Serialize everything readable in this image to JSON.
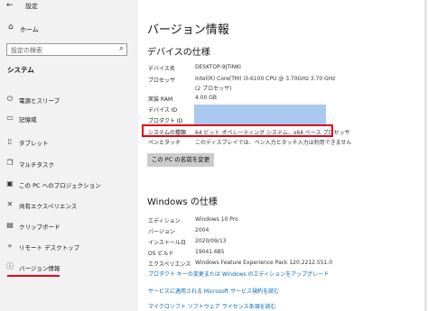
{
  "window": {
    "title": "設定",
    "back_icon": "back-arrow-icon"
  },
  "sidebar": {
    "home_label": "ホーム",
    "search_placeholder": "設定の検索",
    "section_title": "システム",
    "items": [
      {
        "label": "電源とスリープ",
        "icon": "power-icon",
        "glyph": "⏻"
      },
      {
        "label": "記憶域",
        "icon": "storage-icon",
        "glyph": "▭"
      },
      {
        "label": "タブレット",
        "icon": "tablet-icon",
        "glyph": "▯"
      },
      {
        "label": "マルチタスク",
        "icon": "multitask-icon",
        "glyph": "❐"
      },
      {
        "label": "この PC へのプロジェクション",
        "icon": "projection-icon",
        "glyph": "▣"
      },
      {
        "label": "共有エクスペリエンス",
        "icon": "shared-experience-icon",
        "glyph": "✕"
      },
      {
        "label": "クリップボード",
        "icon": "clipboard-icon",
        "glyph": "▤"
      },
      {
        "label": "リモート デスクトップ",
        "icon": "remote-desktop-icon",
        "glyph": "»"
      },
      {
        "label": "バージョン情報",
        "icon": "info-icon",
        "glyph": "ⓘ",
        "selected": true
      }
    ]
  },
  "main": {
    "title": "バージョン情報",
    "device_spec_heading": "デバイスの仕様",
    "device_specs": [
      {
        "key": "デバイス名",
        "value": "DESKTOP-9JTINKI"
      },
      {
        "key": "プロセッサ",
        "value": "Intel(R) Core(TM) i3-6100 CPU @ 3.70GHz   3.70 GHz"
      },
      {
        "key": "",
        "value": "(2 プロセッサ)"
      },
      {
        "key": "実装 RAM",
        "value": "4.00 GB"
      },
      {
        "key": "デバイス ID",
        "value": ""
      },
      {
        "key": "プロダクト ID",
        "value": ""
      },
      {
        "key": "システムの種類",
        "value": "64 ビット オペレーティング システム、x64 ベース プロセッサ"
      },
      {
        "key": "ペンとタッチ",
        "value": "このディスプレイでは、ペン入力とタッチ入力は利用できません"
      }
    ],
    "rename_button": "この PC の名前を変更",
    "windows_spec_heading": "Windows の仕様",
    "windows_specs": [
      {
        "key": "エディション",
        "value": "Windows 10 Pro"
      },
      {
        "key": "バージョン",
        "value": "2004"
      },
      {
        "key": "インストール日",
        "value": "2020/09/13"
      },
      {
        "key": "OS ビルド",
        "value": "19041.685"
      },
      {
        "key": "エクスペリエンス",
        "value": "Windows Feature Experience Pack 120.2212.551.0"
      }
    ],
    "links": [
      "プロダクト キーの変更または Windows のエディションをアップグレード",
      "サービスに適用される Microsoft サービス規約を読む",
      "マイクロソフト ソフトウェア ライセンス条項を読む"
    ],
    "colors": {
      "accent_red": "#e0001b",
      "link_blue": "#0067b8",
      "redaction": "#a9c9f1"
    }
  }
}
